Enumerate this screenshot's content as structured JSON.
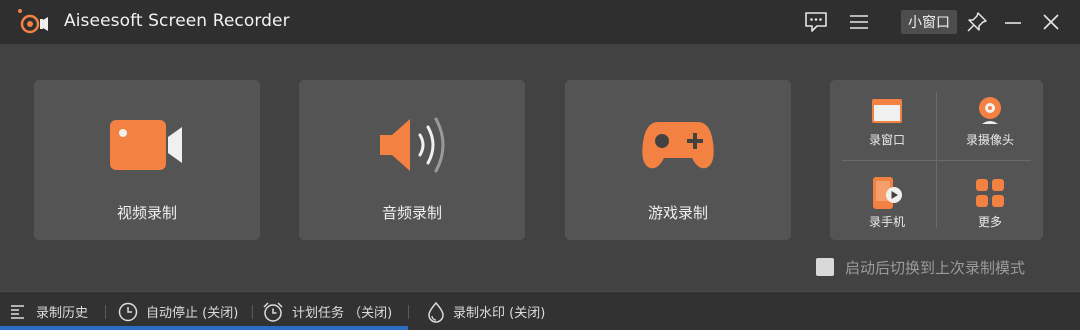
{
  "app": {
    "title": "Aiseesoft Screen Recorder",
    "accent_color": "#f28142"
  },
  "titlebar": {
    "mini_window_label": "小窗口",
    "icons": [
      "feedback-icon",
      "menu-icon",
      "pin-icon",
      "minimize-icon",
      "close-icon"
    ]
  },
  "modes": [
    {
      "label": "视频录制",
      "icon": "video-camera-icon"
    },
    {
      "label": "音频录制",
      "icon": "speaker-icon"
    },
    {
      "label": "游戏录制",
      "icon": "gamepad-icon"
    }
  ],
  "quick": [
    {
      "label": "录窗口",
      "icon": "window-icon"
    },
    {
      "label": "录摄像头",
      "icon": "webcam-icon"
    },
    {
      "label": "录手机",
      "icon": "phone-icon"
    },
    {
      "label": "更多",
      "icon": "grid-icon"
    }
  ],
  "resume_option": {
    "label": "启动后切换到上次录制模式",
    "checked": false
  },
  "footer": [
    {
      "label": "录制历史",
      "icon": "list-icon"
    },
    {
      "label": "自动停止 (关闭)",
      "icon": "clock-icon"
    },
    {
      "label": "计划任务 （关闭)",
      "icon": "alarm-icon"
    },
    {
      "label": "录制水印 (关闭)",
      "icon": "droplet-icon"
    }
  ]
}
